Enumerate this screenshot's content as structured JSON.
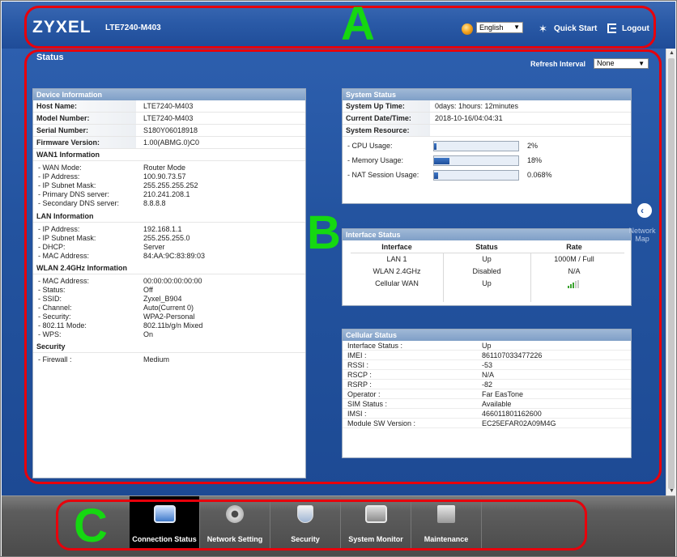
{
  "header": {
    "brand": "ZYXEL",
    "model": "LTE7240-M403",
    "language": "English",
    "quick_start_label": "Quick Start",
    "logout_label": "Logout",
    "globe_icon": "globe-icon",
    "quick_start_icon": "wizard-icon",
    "logout_icon": "logout-icon"
  },
  "page": {
    "title": "Status",
    "refresh_label": "Refresh Interval",
    "refresh_value": "None"
  },
  "device_info": {
    "title": "Device Information",
    "host_name": {
      "label": "Host Name:",
      "value": "LTE7240-M403"
    },
    "model_number": {
      "label": "Model Number:",
      "value": "LTE7240-M403"
    },
    "serial_number": {
      "label": "Serial Number:",
      "value": "S180Y06018918"
    },
    "firmware_version": {
      "label": "Firmware Version:",
      "value": "1.00(ABMG.0)C0"
    },
    "wan_title": "WAN1 Information",
    "wan": [
      {
        "label": "- WAN Mode:",
        "value": "Router Mode"
      },
      {
        "label": "- IP Address:",
        "value": "100.90.73.57"
      },
      {
        "label": "- IP Subnet Mask:",
        "value": "255.255.255.252"
      },
      {
        "label": "- Primary DNS server:",
        "value": "210.241.208.1"
      },
      {
        "label": "- Secondary DNS server:",
        "value": "8.8.8.8"
      }
    ],
    "lan_title": "LAN Information",
    "lan": [
      {
        "label": "- IP Address:",
        "value": "192.168.1.1"
      },
      {
        "label": "- IP Subnet Mask:",
        "value": "255.255.255.0"
      },
      {
        "label": "- DHCP:",
        "value": "Server"
      },
      {
        "label": "- MAC Address:",
        "value": "84:AA:9C:83:89:03"
      }
    ],
    "wlan_title": "WLAN 2.4GHz Information",
    "wlan": [
      {
        "label": "- MAC Address:",
        "value": "00:00:00:00:00:00"
      },
      {
        "label": "- Status:",
        "value": "Off"
      },
      {
        "label": "- SSID:",
        "value": "Zyxel_B904"
      },
      {
        "label": "- Channel:",
        "value": "Auto(Current 0)"
      },
      {
        "label": "- Security:",
        "value": "WPA2-Personal"
      },
      {
        "label": "- 802.11 Mode:",
        "value": "802.11b/g/n Mixed"
      },
      {
        "label": "- WPS:",
        "value": "On"
      }
    ],
    "security_title": "Security",
    "security": [
      {
        "label": "- Firewall :",
        "value": "Medium"
      }
    ]
  },
  "system_status": {
    "title": "System Status",
    "uptime": {
      "label": "System Up Time:",
      "value": "0days: 1hours: 12minutes"
    },
    "datetime": {
      "label": "Current Date/Time:",
      "value": "2018-10-16/04:04:31"
    },
    "resource_title": "System Resource:",
    "resources": [
      {
        "label": "- CPU Usage:",
        "value": "2%",
        "percent": 2
      },
      {
        "label": "- Memory Usage:",
        "value": "18%",
        "percent": 18
      },
      {
        "label": "- NAT Session Usage:",
        "value": "0.068%",
        "percent": 0.068
      }
    ]
  },
  "interface_status": {
    "title": "Interface Status",
    "headers": [
      "Interface",
      "Status",
      "Rate"
    ],
    "rows": [
      {
        "interface": "LAN 1",
        "status": "Up",
        "rate": "1000M / Full"
      },
      {
        "interface": "WLAN 2.4GHz",
        "status": "Disabled",
        "rate": "N/A"
      },
      {
        "interface": "Cellular WAN",
        "status": "Up",
        "rate": "",
        "signal_bars": 3
      }
    ]
  },
  "cellular_status": {
    "title": "Cellular Status",
    "rows": [
      {
        "label": "Interface Status :",
        "value": "Up"
      },
      {
        "label": "IMEI :",
        "value": "861107033477226"
      },
      {
        "label": "RSSI :",
        "value": "-53"
      },
      {
        "label": "RSCP :",
        "value": "N/A"
      },
      {
        "label": "RSRP :",
        "value": "-82"
      },
      {
        "label": "Operator :",
        "value": "Far EasTone"
      },
      {
        "label": "SIM Status :",
        "value": "Available"
      },
      {
        "label": "IMSI :",
        "value": "466011801162600"
      },
      {
        "label": "Module SW Version :",
        "value": "EC25EFAR02A09M4G"
      }
    ]
  },
  "network_map": {
    "label_line1": "Network",
    "label_line2": "Map",
    "icon": "chevron-left-icon"
  },
  "bottom_nav": [
    {
      "label": "Connection Status",
      "icon": "monitor-globe-icon",
      "active": true
    },
    {
      "label": "Network Setting",
      "icon": "gear-icon",
      "active": false
    },
    {
      "label": "Security",
      "icon": "shield-icon",
      "active": false
    },
    {
      "label": "System Monitor",
      "icon": "chart-icon",
      "active": false
    },
    {
      "label": "Maintenance",
      "icon": "tools-icon",
      "active": false
    }
  ],
  "annotations": [
    "A",
    "B",
    "C"
  ],
  "colors": {
    "annotation_border": "#e8000b",
    "annotation_letter": "#15d811",
    "header_blue": "#2a5aa7"
  }
}
